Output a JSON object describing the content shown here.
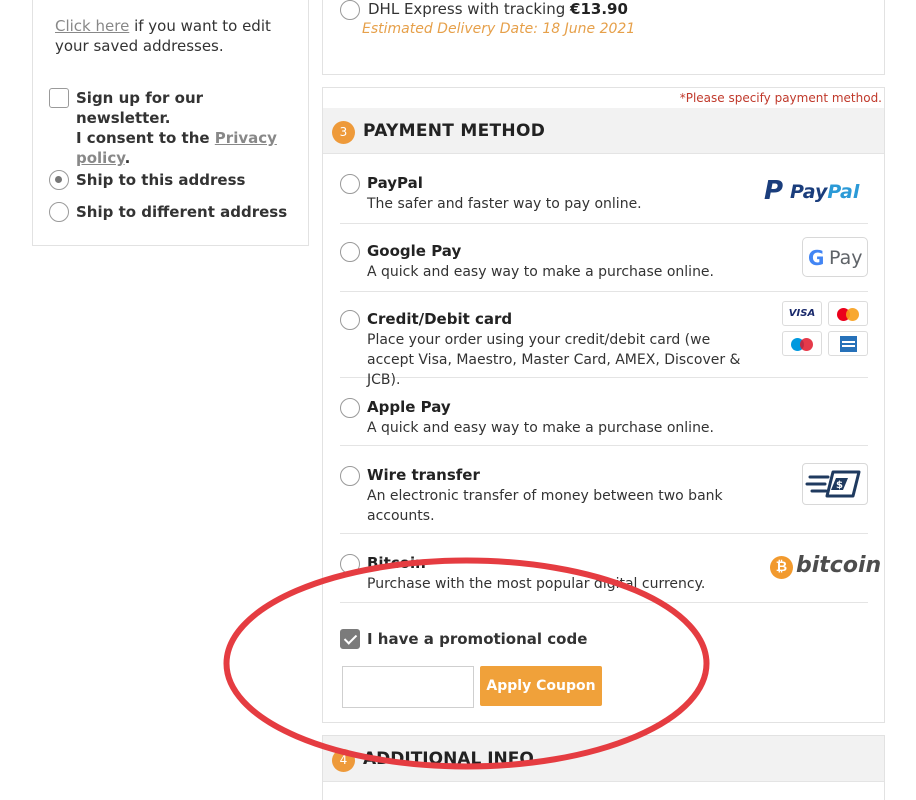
{
  "left": {
    "saved_link": "Click here",
    "saved_text": " if you want to edit your saved addresses.",
    "newsletter_line1": "Sign up for our newsletter.",
    "newsletter_line2": "I consent to the ",
    "privacy_link": "Privacy policy",
    "period": ".",
    "ship_options": [
      {
        "label": "Ship to this address",
        "selected": true
      },
      {
        "label": "Ship to different address",
        "selected": false
      }
    ]
  },
  "shipping": {
    "dhl_label": "DHL Express with tracking ",
    "dhl_price": "€13.90",
    "estimated": "Estimated Delivery Date: 18 June 2021"
  },
  "payment": {
    "required_note": "*Please specify payment method.",
    "step": "3",
    "title": "PAYMENT METHOD",
    "methods": [
      {
        "name": "PayPal",
        "desc": "The safer and faster way to pay online.",
        "icon": "paypal-logo"
      },
      {
        "name": "Google Pay",
        "desc": "A quick and easy way to make a purchase online.",
        "icon": "google-pay-logo"
      },
      {
        "name": "Credit/Debit card",
        "desc": "Place your order using your credit/debit card (we accept Visa, Maestro, Master Card, AMEX, Discover & JCB).",
        "icon": "card-logos"
      },
      {
        "name": "Apple Pay",
        "desc": "A quick and easy way to make a purchase online.",
        "icon": ""
      },
      {
        "name": "Wire transfer",
        "desc": "An electronic transfer of money between two bank accounts.",
        "icon": "wire-transfer-icon"
      },
      {
        "name": "Bitcoin",
        "desc": "Purchase with the most popular digital currency.",
        "icon": "bitcoin-logo"
      }
    ],
    "logos": {
      "paypal_a": "Pay",
      "paypal_b": "Pal",
      "paypal_p": "P",
      "gpay_g": "G",
      "gpay_pay": "Pay",
      "visa": "VISA",
      "bitcoin_symbol": "₿",
      "bitcoin_word": "bitcoin"
    },
    "promo_label": "I have a promotional code",
    "promo_checked": true,
    "coupon_value": "",
    "coupon_button": "Apply Coupon"
  },
  "additional": {
    "step": "4",
    "title": "ADDITIONAL INFO"
  },
  "colors": {
    "accent": "#f0a13a",
    "annotation": "#e53c41",
    "estimate": "#e6a04a",
    "required": "#c0392b"
  }
}
